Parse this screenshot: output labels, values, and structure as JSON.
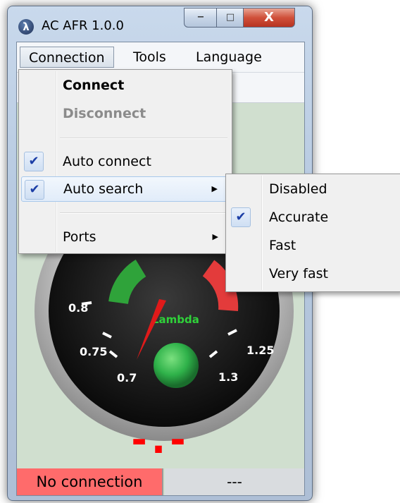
{
  "window": {
    "title": "AC AFR  1.0.0",
    "app_icon_glyph": "λ",
    "min_glyph": "−",
    "max_glyph": "□",
    "close_glyph": "X"
  },
  "menubar": {
    "items": [
      {
        "label": "Connection"
      },
      {
        "label": "Tools"
      },
      {
        "label": "Language"
      }
    ]
  },
  "connection_menu": {
    "connect": "Connect",
    "disconnect": "Disconnect",
    "auto_connect": "Auto connect",
    "auto_search": "Auto search",
    "ports": "Ports",
    "check_glyph": "✔",
    "arrow_glyph": "▶"
  },
  "auto_search_menu": {
    "options": [
      "Disabled",
      "Accurate",
      "Fast",
      "Very fast"
    ],
    "selected": "Accurate"
  },
  "gauge": {
    "ticks": [
      "0.7",
      "0.75",
      "0.8",
      "1.25",
      "1.3"
    ],
    "label": "Lambda",
    "value": 0.7,
    "colors": {
      "green_zone": "#2fa33a",
      "red_zone": "#e33b3b",
      "needle": "#e01a1a",
      "bulb": "#2fb24a"
    }
  },
  "readout": {
    "text": "-.-"
  },
  "status": {
    "connection": "No connection",
    "value": "---"
  }
}
